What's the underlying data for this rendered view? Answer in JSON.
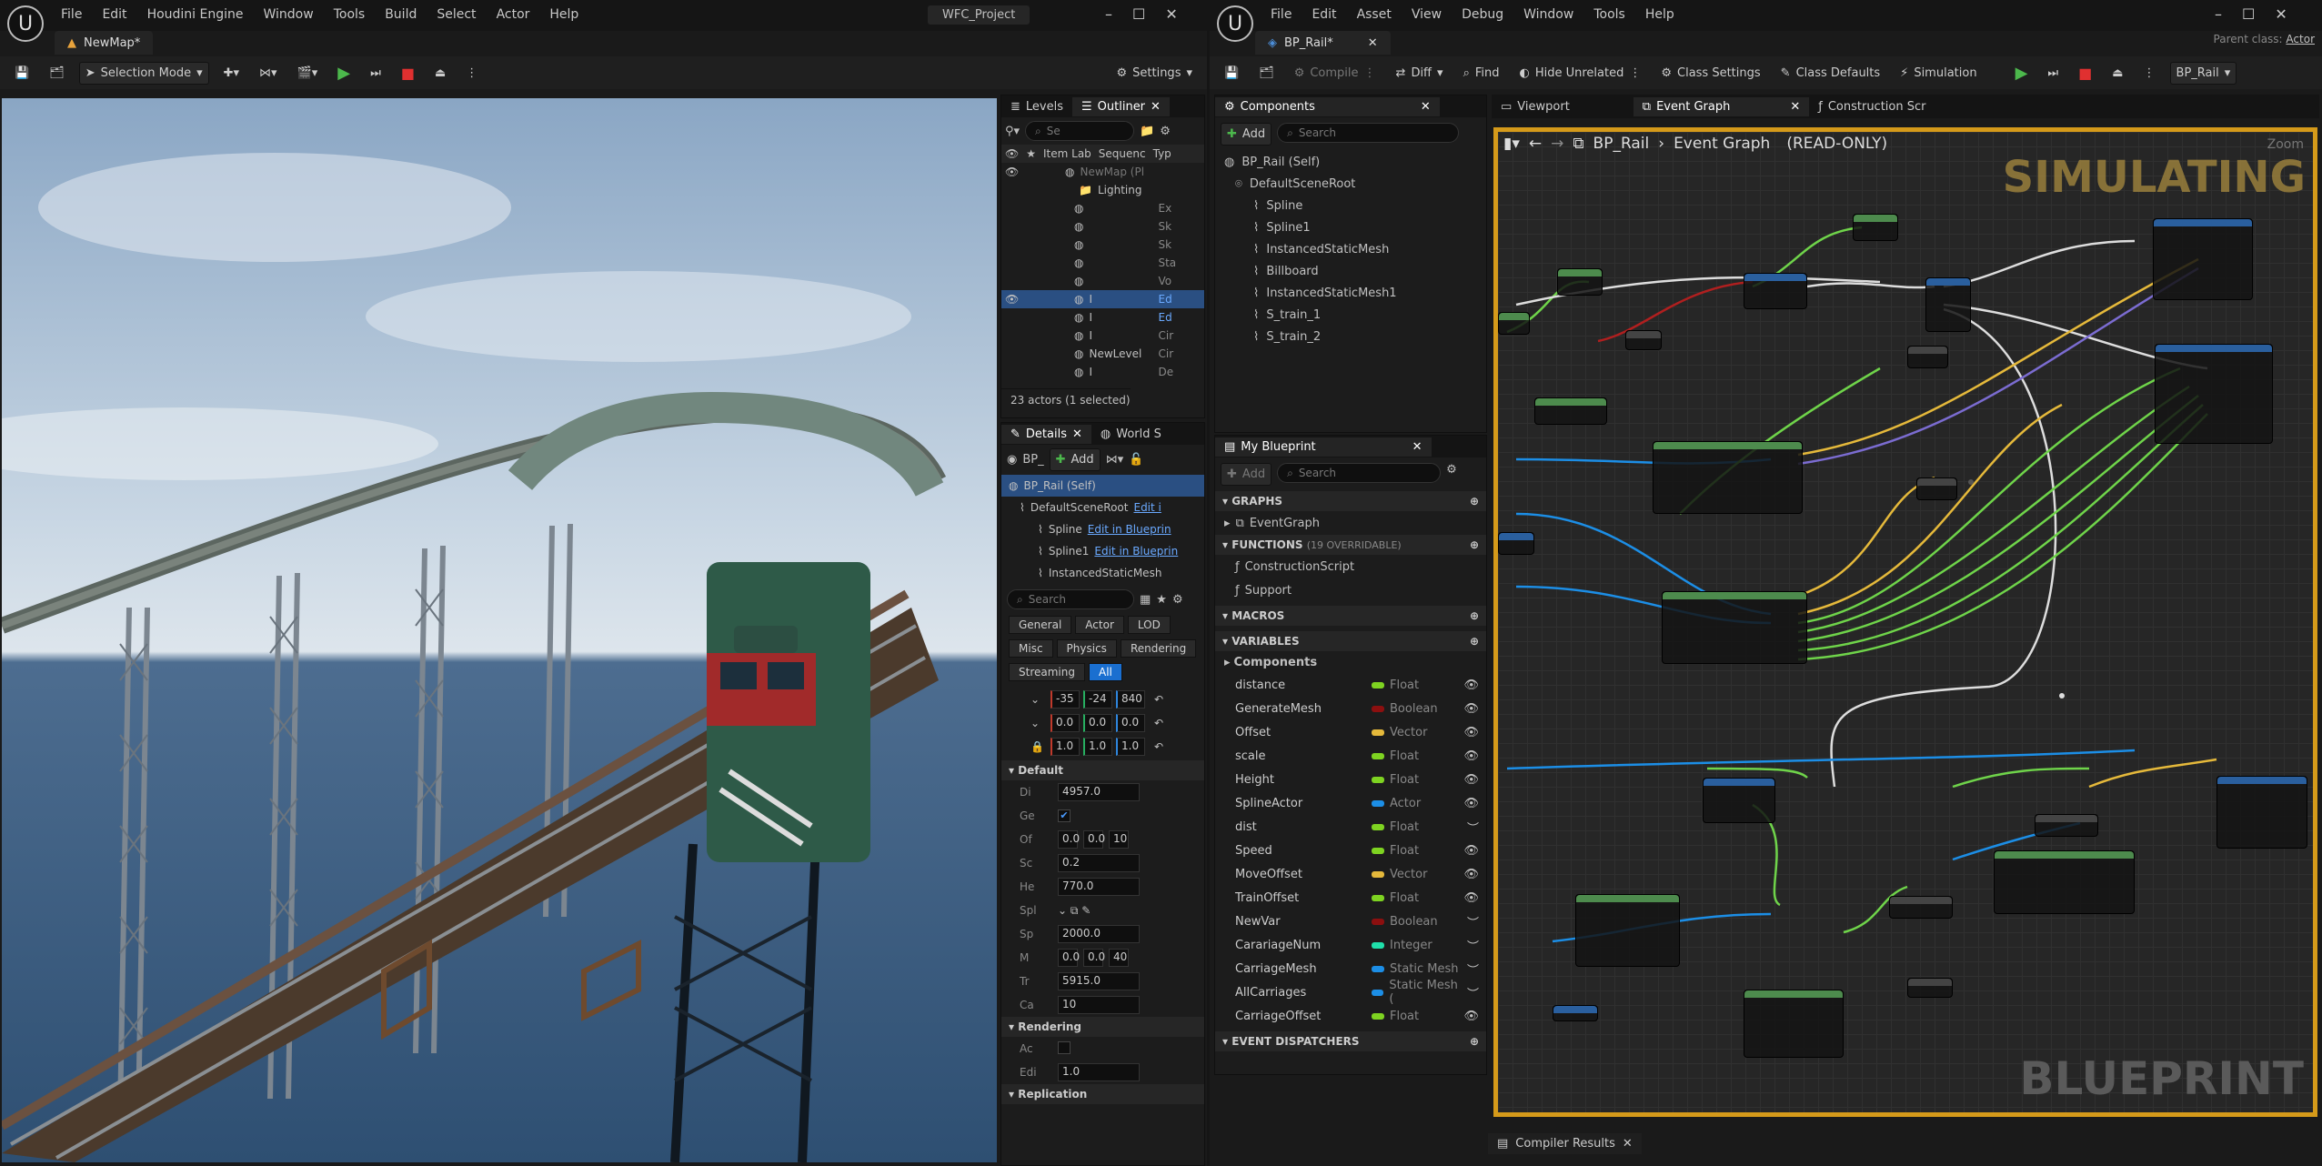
{
  "left_window": {
    "menu": [
      "File",
      "Edit",
      "Houdini Engine",
      "Window",
      "Tools",
      "Build",
      "Select",
      "Actor",
      "Help"
    ],
    "project": "WFC_Project",
    "doc_tab": "NewMap*",
    "toolbar": {
      "mode": "Selection Mode",
      "settings": "Settings"
    },
    "outliner": {
      "tabs": [
        "Levels",
        "Outliner"
      ],
      "search_placeholder": "Se",
      "columns": [
        "Item Lab",
        "Sequenc",
        "Typ"
      ],
      "rows": [
        {
          "label": "NewMap (Play In Ed",
          "type": ""
        },
        {
          "label": "Lighting",
          "type": ""
        },
        {
          "label": "",
          "type": "Ex"
        },
        {
          "label": "",
          "type": "Sk"
        },
        {
          "label": "",
          "type": "Sk"
        },
        {
          "label": "",
          "type": "Sta"
        },
        {
          "label": "",
          "type": "Vo"
        },
        {
          "label": "I",
          "type": "Ed"
        },
        {
          "label": "I",
          "type": "Ed"
        },
        {
          "label": "I",
          "type": "Cir"
        },
        {
          "label": "NewLevel",
          "type": "Cir"
        },
        {
          "label": "I",
          "type": "De"
        }
      ],
      "status": "23 actors (1 selected)"
    },
    "details": {
      "tabs": [
        "Details",
        "World S"
      ],
      "actor": "BP_",
      "add": "Add",
      "tree": [
        {
          "label": "BP_Rail (Self)",
          "link": ""
        },
        {
          "label": "DefaultSceneRoot",
          "link": "Edit i"
        },
        {
          "label": "Spline",
          "link": "Edit in Blueprin"
        },
        {
          "label": "Spline1",
          "link": "Edit in Blueprin"
        },
        {
          "label": "InstancedStaticMesh",
          "link": ""
        }
      ],
      "search_placeholder": "Search",
      "filters": [
        "General",
        "Actor",
        "LOD",
        "Misc",
        "Physics",
        "Rendering",
        "Streaming",
        "All"
      ],
      "transform": [
        [
          "-35",
          "-24",
          "840"
        ],
        [
          "0.0",
          "0.0",
          "0.0"
        ],
        [
          "1.0",
          "1.0",
          "1.0"
        ]
      ],
      "section_default": "Default",
      "props": [
        {
          "k": "Di",
          "v": "4957.0"
        },
        {
          "k": "Ge",
          "v": "checked"
        },
        {
          "k": "Of",
          "v": "0.0|0.0|10"
        },
        {
          "k": "Sc",
          "v": "0.2"
        },
        {
          "k": "He",
          "v": "770.0"
        },
        {
          "k": "Spl",
          "v": ""
        },
        {
          "k": "Sp",
          "v": "2000.0"
        },
        {
          "k": "M",
          "v": "0.0|0.0|40"
        },
        {
          "k": "Tr",
          "v": "5915.0"
        },
        {
          "k": "Ca",
          "v": "10"
        }
      ],
      "section_rendering": "Rendering",
      "render_props": [
        {
          "k": "Ac",
          "v": ""
        },
        {
          "k": "Edi",
          "v": "1.0"
        }
      ],
      "section_replication": "Replication"
    }
  },
  "right_window": {
    "menu": [
      "File",
      "Edit",
      "Asset",
      "View",
      "Debug",
      "Window",
      "Tools",
      "Help"
    ],
    "doc_tab": "BP_Rail*",
    "parent_class_label": "Parent class:",
    "parent_class": "Actor",
    "toolbar": [
      "Compile",
      "Diff",
      "Find",
      "Hide Unrelated",
      "Class Settings",
      "Class Defaults",
      "Simulation",
      "BP_Rail"
    ],
    "components": {
      "title": "Components",
      "add": "Add",
      "search_placeholder": "Search",
      "items": [
        "BP_Rail (Self)",
        "DefaultSceneRoot",
        "Spline",
        "Spline1",
        "InstancedStaticMesh",
        "Billboard",
        "InstancedStaticMesh1",
        "S_train_1",
        "S_train_2"
      ]
    },
    "my_blueprint": {
      "title": "My Blueprint",
      "add": "Add",
      "search_placeholder": "Search",
      "graphs": "GRAPHS",
      "event_graph": "EventGraph",
      "functions": "FUNCTIONS",
      "functions_count": "(19 OVERRIDABLE)",
      "function_items": [
        "ConstructionScript",
        "Support"
      ],
      "macros": "MACROS",
      "variables": "VARIABLES",
      "components_cat": "Components",
      "vars": [
        {
          "n": "distance",
          "t": "Float",
          "c": "#7ed321"
        },
        {
          "n": "GenerateMesh",
          "t": "Boolean",
          "c": "#8c0f0f"
        },
        {
          "n": "Offset",
          "t": "Vector",
          "c": "#e5b93b"
        },
        {
          "n": "scale",
          "t": "Float",
          "c": "#7ed321"
        },
        {
          "n": "Height",
          "t": "Float",
          "c": "#7ed321"
        },
        {
          "n": "SplineActor",
          "t": "Actor",
          "c": "#1c8ee6"
        },
        {
          "n": "dist",
          "t": "Float",
          "c": "#7ed321"
        },
        {
          "n": "Speed",
          "t": "Float",
          "c": "#7ed321"
        },
        {
          "n": "MoveOffset",
          "t": "Vector",
          "c": "#e5b93b"
        },
        {
          "n": "TrainOffset",
          "t": "Float",
          "c": "#7ed321"
        },
        {
          "n": "NewVar",
          "t": "Boolean",
          "c": "#8c0f0f"
        },
        {
          "n": "CarariageNum",
          "t": "Integer",
          "c": "#1fe0aa"
        },
        {
          "n": "CarriageMesh",
          "t": "Static Mesh",
          "c": "#1c8ee6"
        },
        {
          "n": "AllCarriages",
          "t": "Static Mesh (",
          "c": "#1c8ee6"
        },
        {
          "n": "CarriageOffset",
          "t": "Float",
          "c": "#7ed321"
        }
      ],
      "dispatchers": "EVENT DISPATCHERS"
    },
    "graph": {
      "tabs": [
        "Viewport",
        "Event Graph",
        "Construction Scr"
      ],
      "breadcrumb_root": "BP_Rail",
      "breadcrumb_leaf": "Event Graph",
      "readonly": "(READ-ONLY)",
      "zoom": "Zoom",
      "simulating": "SIMULATING",
      "watermark": "BLUEPRINT"
    },
    "compiler_results": "Compiler Results"
  }
}
